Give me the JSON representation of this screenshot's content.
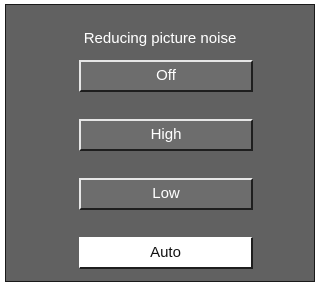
{
  "menu": {
    "title": "Reducing picture noise",
    "options": [
      {
        "label": "Off",
        "selected": false
      },
      {
        "label": "High",
        "selected": false
      },
      {
        "label": "Low",
        "selected": false
      },
      {
        "label": "Auto",
        "selected": true
      }
    ]
  },
  "colors": {
    "panel_background": "#616161",
    "button_background": "#6d6d6d",
    "selected_background": "#ffffff",
    "text": "#ffffff",
    "selected_text": "#111111"
  }
}
